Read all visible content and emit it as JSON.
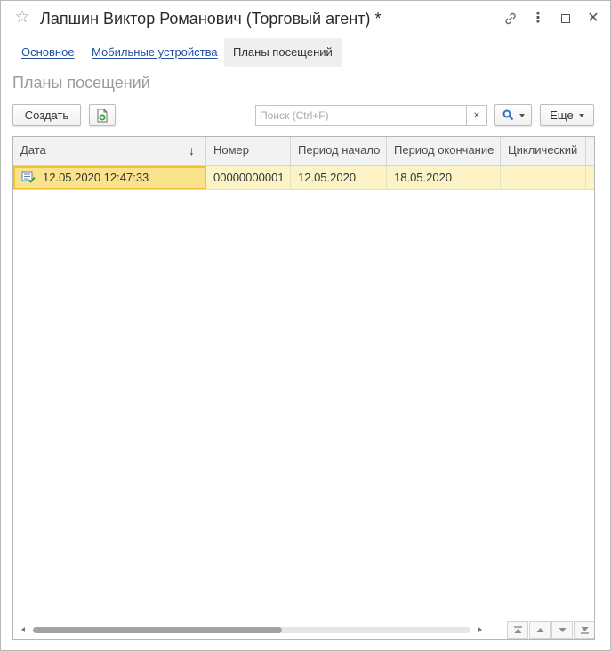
{
  "window": {
    "title": "Лапшин Виктор Романович (Торговый агент) *",
    "icons": {
      "favorite": "star-icon",
      "link": "link-icon",
      "more": "more-vertical-icon",
      "maximize": "maximize-icon",
      "close": "close-icon"
    }
  },
  "tabs": [
    {
      "label": "Основное",
      "active": false
    },
    {
      "label": "Мобильные устройства",
      "active": false
    },
    {
      "label": "Планы посещений",
      "active": true
    }
  ],
  "section_title": "Планы посещений",
  "toolbar": {
    "create_label": "Создать",
    "copy_icon": "add-document-icon",
    "search_placeholder": "Поиск (Ctrl+F)",
    "search_value": "",
    "clear_label": "×",
    "find_icon": "search-icon",
    "more_label": "Еще"
  },
  "grid": {
    "columns": [
      {
        "label": "Дата",
        "sort": "↓"
      },
      {
        "label": "Номер"
      },
      {
        "label": "Период начало"
      },
      {
        "label": "Период окончание"
      },
      {
        "label": "Циклический"
      }
    ],
    "rows": [
      {
        "icon": "document-posted-icon",
        "date": "12.05.2020 12:47:33",
        "number": "00000000001",
        "period_start": "12.05.2020",
        "period_end": "18.05.2020",
        "cyclic": ""
      }
    ]
  },
  "colors": {
    "accent_link": "#2350a0",
    "row_selected": "#fcf3c6",
    "cell_focused": "#fbe38e",
    "focus_border": "#f1c232"
  }
}
